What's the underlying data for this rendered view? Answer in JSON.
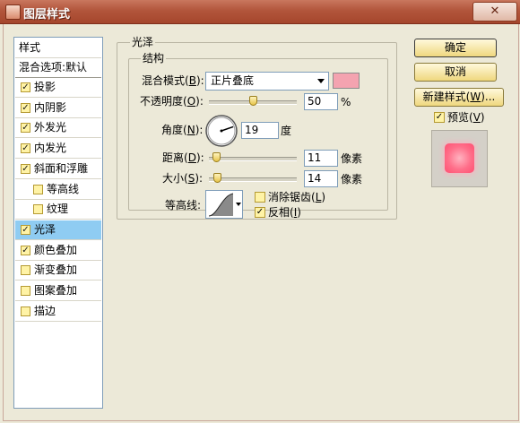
{
  "window": {
    "title": "图层样式",
    "close_glyph": "✕"
  },
  "sidebar": {
    "header": "样式",
    "blend_default": "混合选项:默认",
    "items": [
      {
        "label": "投影",
        "checked": true,
        "indent": false,
        "selected": false
      },
      {
        "label": "内阴影",
        "checked": true,
        "indent": false,
        "selected": false
      },
      {
        "label": "外发光",
        "checked": true,
        "indent": false,
        "selected": false
      },
      {
        "label": "内发光",
        "checked": true,
        "indent": false,
        "selected": false
      },
      {
        "label": "斜面和浮雕",
        "checked": true,
        "indent": false,
        "selected": false
      },
      {
        "label": "等高线",
        "checked": false,
        "indent": true,
        "selected": false
      },
      {
        "label": "纹理",
        "checked": false,
        "indent": true,
        "selected": false
      },
      {
        "label": "光泽",
        "checked": true,
        "indent": false,
        "selected": true
      },
      {
        "label": "颜色叠加",
        "checked": true,
        "indent": false,
        "selected": false
      },
      {
        "label": "渐变叠加",
        "checked": false,
        "indent": false,
        "selected": false
      },
      {
        "label": "图案叠加",
        "checked": false,
        "indent": false,
        "selected": false
      },
      {
        "label": "描边",
        "checked": false,
        "indent": false,
        "selected": false
      }
    ]
  },
  "panel": {
    "group_title": "光泽",
    "structure_title": "结构",
    "blend_mode": {
      "label": "混合模式",
      "key": "B",
      "value": "正片叠底",
      "color": "#F4A3B0"
    },
    "opacity": {
      "label": "不透明度",
      "key": "O",
      "value": "50",
      "unit": "%",
      "percent": 50
    },
    "angle": {
      "label": "角度",
      "key": "N",
      "value": "19",
      "unit": "度",
      "degrees": 19
    },
    "distance": {
      "label": "距离",
      "key": "D",
      "value": "11",
      "unit": "像素",
      "max": 250
    },
    "size": {
      "label": "大小",
      "key": "S",
      "value": "14",
      "unit": "像素",
      "max": 250
    },
    "contour": {
      "label": "等高线:"
    },
    "anti_alias": {
      "label": "消除锯齿",
      "key": "L",
      "checked": false
    },
    "invert": {
      "label": "反相",
      "key": "I",
      "checked": true
    }
  },
  "buttons": {
    "ok": "确定",
    "cancel": "取消",
    "new_style": "新建样式",
    "new_style_key": "W",
    "new_style_suffix": "..."
  },
  "preview": {
    "label": "预览",
    "key": "V",
    "checked": true
  }
}
